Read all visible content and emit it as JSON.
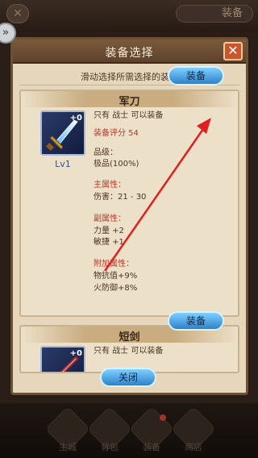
{
  "topbar": {
    "right_button_label": "装备"
  },
  "bottom_nav": [
    {
      "label": "主城"
    },
    {
      "label": "背包"
    },
    {
      "label": "装备"
    },
    {
      "label": "商店"
    }
  ],
  "modal": {
    "title": "装备选择",
    "close_glyph": "✕",
    "subtitle": "滑动选择所需选择的装备",
    "close_button_label": "关闭"
  },
  "items": [
    {
      "name": "军刀",
      "plus": "+0",
      "level": "Lv1",
      "restriction": "只有 战士 可以装备",
      "score": "装备评分 54",
      "quality_title": "品级：",
      "quality": "极品(100%)",
      "main_attr_title": "主属性：",
      "main_attr": "伤害：21 - 30",
      "sub_attr_title": "副属性：",
      "sub_attrs": [
        "力量 +2",
        "敏捷 +1"
      ],
      "extra_attr_title": "附加属性：",
      "extra_attrs": [
        "物抗值+9%",
        "火防御+8%"
      ],
      "equip_label": "装备"
    },
    {
      "name": "短剑",
      "plus": "+0",
      "restriction": "只有 战士 可以装备",
      "equip_label": "装备"
    }
  ],
  "colors": {
    "accent_blue": "#2d82c8",
    "arrow_red": "#e02020",
    "close_orange": "#c9572b"
  }
}
